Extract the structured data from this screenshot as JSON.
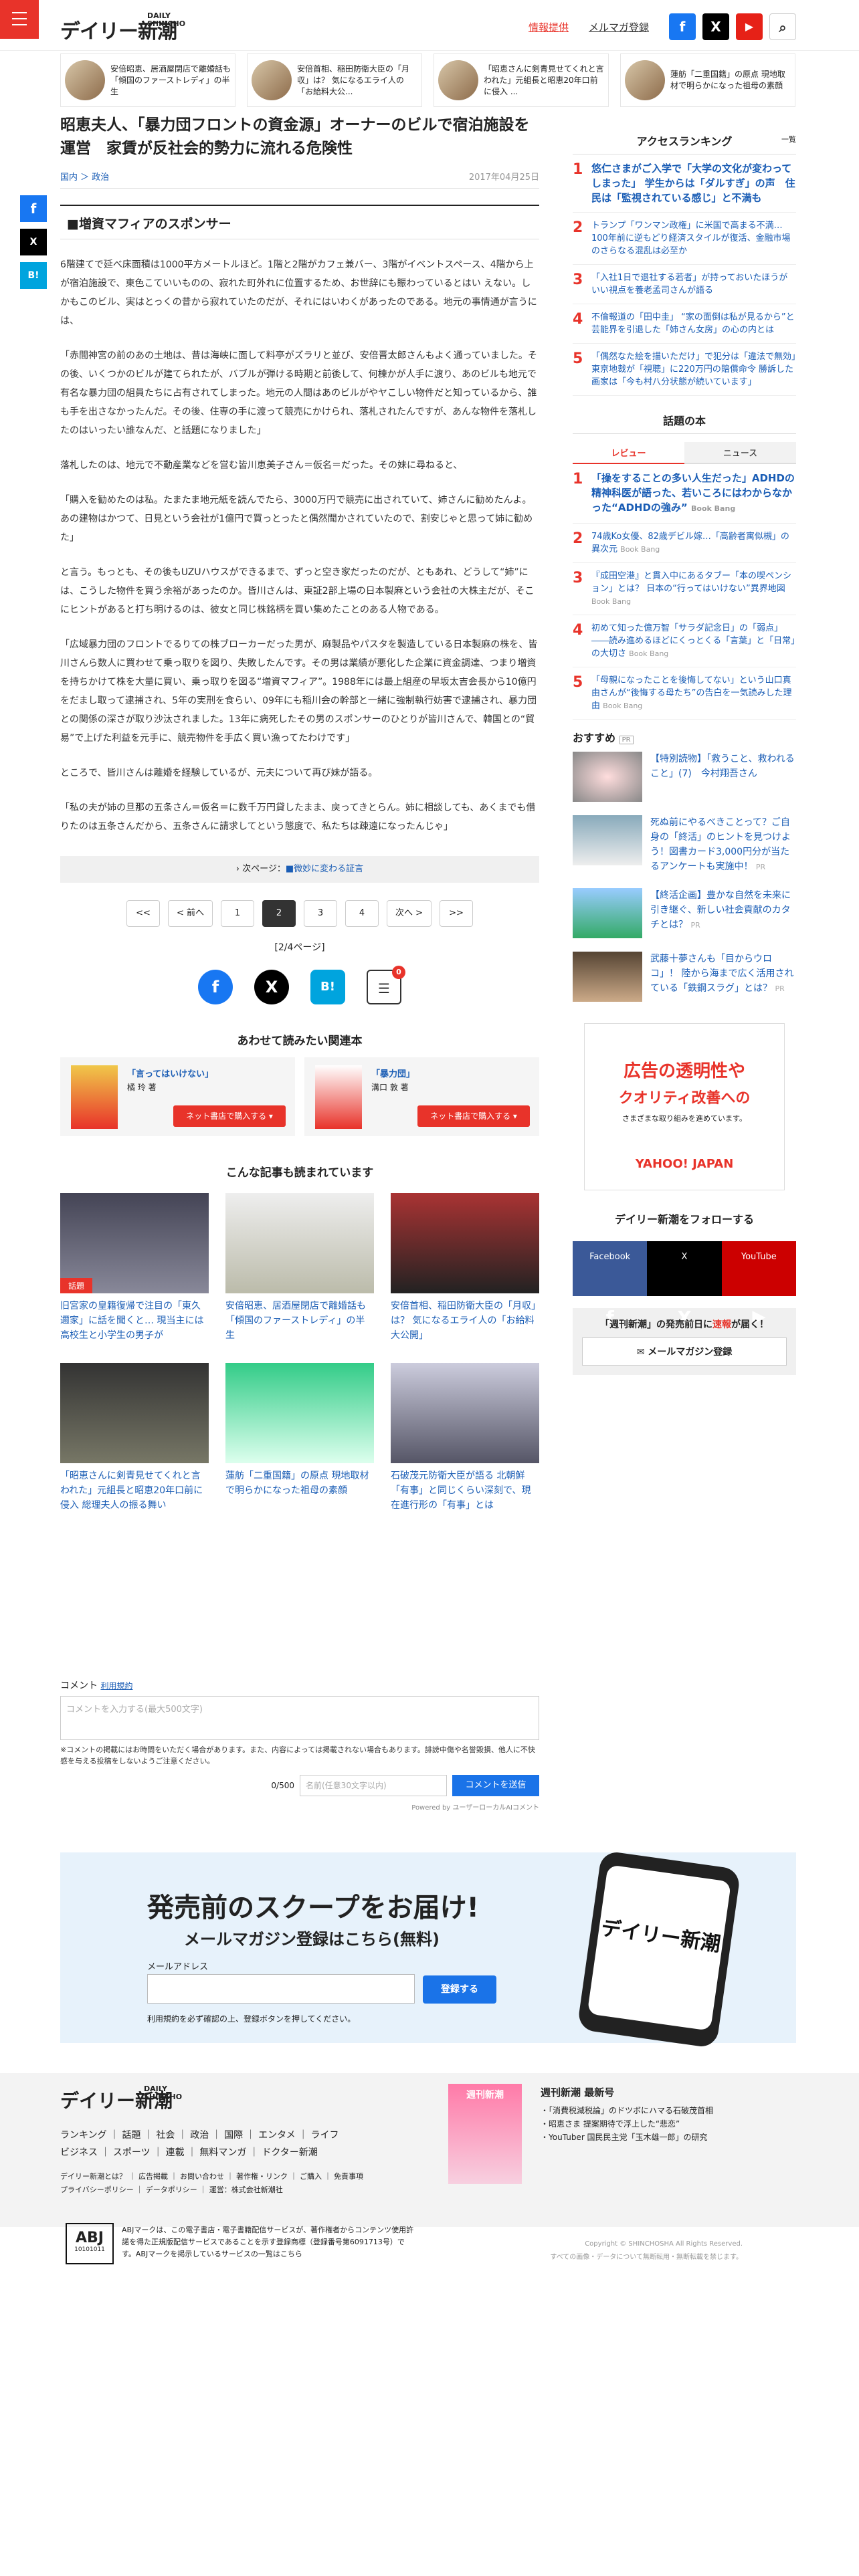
{
  "header": {
    "logo": "デイリー新潮",
    "logo_en": "DAILY SHINCHO",
    "link1": "情報提供",
    "link2": "メルマガ登録",
    "fb": "f",
    "x": "X",
    "yt": "▶",
    "search": "⌕"
  },
  "strip": [
    {
      "text": "安倍昭恵、居酒屋閉店で離婚話も「傾国のファーストレディ」の半生"
    },
    {
      "text": "安倍首相、稲田防衛大臣の「月収」は？ 気になるエライ人の「お給料大公..."
    },
    {
      "text": "「昭恵さんに剣青見せてくれと言われた」元組長と昭恵20年口前に侵入 ..."
    },
    {
      "text": "蓮舫「二重国籍」の原点 現地取材で明らかになった祖母の素顔"
    }
  ],
  "article": {
    "title": "昭恵夫人、「暴力団フロントの資金源」オーナーのビルで宿泊施設を運営　家賃が反社会的勢力に流れる危険性",
    "cat1": "国内",
    "cat2": "政治",
    "date": "2017年04月25日",
    "section": "■増資マフィアのスポンサー",
    "paras": [
      "6階建てで延べ床面積は1000平方メートルほど。1階と2階がカフェ兼バー、3階がイベントスペース、4階から上が宿泊施設で、東色こていいものの、寂れた町外れに位置するため、お世辞にも賑わっているとはい えない。しかもこのビル、実はとっくの昔から寂れていたのだが、それにはいわくがあったのである。地元の事情通が言うには、",
      "「赤間神宮の前のあの土地は、昔は海峡に面して料亭がズラリと並び、安倍晋太郎さんもよく通っていました。その後、いくつかのビルが建てられたが、バブルが弾ける時期と前後して、何棟かが人手に渡り、あのビルも地元で有名な暴力団の組員たちに占有されてしまった。地元の人間はあのビルがやヤこしい物件だと知っているから、誰も手を出さなかったんだ。その後、住専の手に渡って競売にかけられ、落札されたんですが、あんな物件を落札したのはいったい誰なんだ、と話題になりました」",
      "落札したのは、地元で不動産業などを営む皆川恵美子さん＝仮名＝だった。その妹に尋ねると、",
      "「購入を勧めたのは私。たまたま地元紙を読んでたら、3000万円で競売に出されていて、姉さんに勧めたんよ。あの建物はかつて、日見という会社が1億円で買っとったと偶然聞かされていたので、割安じゃと思って姉に勧めた」",
      "と言う。もっとも、その後もUZUハウスができるまで、ずっと空き家だったのだが、ともあれ、どうして“姉”には、こうした物件を買う余裕があったのか。皆川さんは、東証2部上場の日本製麻という会社の大株主だが、そこにヒントがあると打ち明けるのは、彼女と同じ株銘柄を買い集めたことのある人物である。",
      "「広域暴力団のフロントでるりての株ブローカーだった男が、麻製品やパスタを製造している日本製麻の株を、皆川さんら数人に買わせて乗っ取りを図り、失敗したんです。その男は業績が悪化した企業に資金調達、つまり増資を持ちかけて株を大量に買い、乗っ取りを図る“増資マフィア”。1988年には最上組産の早坂太吉会長から10億円をだまし取って逮捕され、5年の実刑を食らい、09年にも稲川会の幹部と一緒に強制執行妨害で逮捕され、暴力団との関係の深さが取り沙汰されました。13年に病死したその男のスポンサーのひとりが皆川さんで、韓国との“貿易”で上げた利益を元手に、競売物件を手広く買い漁ってたわけです」",
      "ところで、皆川さんは離婚を経験しているが、元夫について再び妹が語る。",
      "「私の夫が姉の旦那の五条さん＝仮名＝に数千万円貸したまま、戻ってきとらん。姉に相談しても、あくまでも借りたのは五条さんだから、五条さんに請求してという態度で、私たちは疎遠になったんじゃ」"
    ],
    "next_label": "次ページ：",
    "next_link": "■微妙に変わる証言",
    "pager": [
      "<<",
      "< 前へ",
      "1",
      "2",
      "3",
      "4",
      "次へ >",
      ">>"
    ],
    "page_status": "[2/4ページ]",
    "comment_count": "0"
  },
  "books": {
    "heading": "あわせて読みたい関連本",
    "items": [
      {
        "title": "「言ってはいけない」",
        "author": "橘 玲 著",
        "buy": "ネット書店で購入する ▾"
      },
      {
        "title": "「暴力団」",
        "author": "溝口 敦 著",
        "buy": "ネット書店で購入する ▾"
      }
    ]
  },
  "related": {
    "heading": "こんな記事も読まれています",
    "items": [
      {
        "title": "旧宮家の皇籍復帰で注目の「東久邇家」に話を聞くと… 現当主には高校生と小学生の男子が",
        "tag": "話題"
      },
      {
        "title": "安倍昭恵、居酒屋閉店で離婚話も 「傾国のファーストレディ」の半生",
        "tag": ""
      },
      {
        "title": "安倍首相、稲田防衛大臣の「月収」は？ 気になるエライ人の「お給料大公開」",
        "tag": ""
      },
      {
        "title": "「昭恵さんに剣青見せてくれと言われた」元組長と昭恵20年口前に侵入 総理夫人の振る舞い",
        "tag": ""
      },
      {
        "title": "蓮舫「二重国籍」の原点 現地取材で明らかになった祖母の素顔",
        "tag": ""
      },
      {
        "title": "石破茂元防衛大臣が語る 北朝鮮「有事」と同じくらい深刻で、現在進行形の「有事」とは",
        "tag": ""
      }
    ]
  },
  "comments": {
    "label": "コメント",
    "rule": "利用規約",
    "placeholder": "コメントを入力する(最大500文字)",
    "note": "※コメントの掲載にはお時間をいただく場合があります。また、内容によっては掲載されない場合もあります。誹謗中傷や名誉毀損、他人に不快感を与える投稿をしないようご注意ください。",
    "count": "0/500",
    "name_ph": "名前(任意30文字以内)",
    "send": "コメントを送信",
    "powered": "Powered by ユーザーローカルAIコメント"
  },
  "banner": {
    "title": "発売前のスクープをお届け!",
    "sub": "メールマガジン登録はこちら(無料)",
    "email_label": "メールアドレス",
    "btn": "登録する",
    "note": "利用規約を必ず確認の上、登録ボタンを押してください。",
    "phone": "デイリー新潮"
  },
  "sidebar": {
    "access": "アクセスランキング",
    "all": "一覧",
    "ranking": [
      {
        "n": "1",
        "t": "悠仁さまがご入学で「大学の文化が変わってしまった」 学生からは「ダルすぎ」の声　住民は「監視されている感じ」と不満も",
        "big": true
      },
      {
        "n": "2",
        "t": "トランプ「ワンマン政権」に米国で高まる不満…100年前に逆もどり経済スタイルが復活、金融市場のさらなる混乱は必至か",
        "big": false
      },
      {
        "n": "3",
        "t": "「入社1日で退社する若者」が持っておいたほうがいい視点を養老孟司さんが語る",
        "big": false
      },
      {
        "n": "4",
        "t": "不倫報道の「田中圭」 “家の面倒は私が見るから”と芸能界を引退した「姉さん女房」の心の内とは",
        "big": false
      },
      {
        "n": "5",
        "t": "「偶然なた絵を描いただけ」で犯分は「違法で無効」東京地裁が「視聴」に220万円の賠償命令 勝訴した画家は「今も村八分状態が続いています」",
        "big": false
      }
    ],
    "books_head": "話題の本",
    "tab1": "レビュー",
    "tab2": "ニュース",
    "book_rank": [
      {
        "n": "1",
        "t": "「操をすることの多い人生だった」ADHDの精神科医が語った、若いころにはわからなかった“ADHDの強み”",
        "em": "Book Bang",
        "big": true
      },
      {
        "n": "2",
        "t": "74歳Ko女優、82歳デビル嫁…「高齢者寓似槻」の異次元",
        "em": "Book Bang",
        "big": false
      },
      {
        "n": "3",
        "t": "『成田空港』と貫入中にあるタブー「本の喫ペンション」とは？ 日本の“行ってはいけない”異界地図",
        "em": "Book Bang",
        "big": false
      },
      {
        "n": "4",
        "t": "初めて知った億万智「サラダ記念日」の「弱点」――読み進めるほどにくっとくる「言葉」と「日常」の大切さ",
        "em": "Book Bang",
        "big": false
      },
      {
        "n": "5",
        "t": "「母親になったことを後悔してない」という山口真由さんが“後悔する母たち”の告白を一気読みした理由",
        "em": "Book Bang",
        "big": false
      }
    ],
    "osusume": "おすすめ",
    "pr": "PR",
    "recs": [
      {
        "t": "【特別読物】「救うこと、救われること」(7)　今村翔吾さん",
        "pr": "PR"
      },
      {
        "t": "死ぬ前にやるべきことって？ご自身の「終活」のヒントを見つけよう！図書カード3,000円分が当たるアンケートも実施中！",
        "pr": "PR"
      },
      {
        "t": "【終活企画】豊かな自然を未来に引き継ぐ、新しい社会貢献のカタチとは？",
        "pr": "PR"
      },
      {
        "t": "武藤十夢さんも「目からウロコ」！ 陸から海まで広く活用されている「鉄鋼スラグ」とは？",
        "pr": "PR"
      }
    ],
    "ad_line1": "広告の透明性や",
    "ad_line2": "クオリティ改善への",
    "ad_line3": "さまざまな取り組みを進めています。",
    "ad_brand": "YAHOO! JAPAN",
    "follow": "デイリー新潮をフォローする",
    "fb": "Facebook",
    "x": "X",
    "yt": "YouTube",
    "mail1": "「週刊新潮」の発売前日に",
    "mail2": "速報",
    "mail3": "が届く！",
    "mail_btn": "メールマガジン登録"
  },
  "footer": {
    "logo": "デイリー新潮",
    "logo_en": "DAILY SHINCHO",
    "nav1": "ランキング ｜ 話題 ｜ 社会 ｜ 政治 ｜ 国際 ｜ エンタメ ｜ ライフ",
    "nav2": "ビジネス ｜ スポーツ ｜ 連載 ｜ 無料マンガ ｜ ドクター新潮",
    "small1": "デイリー新潮とは？ ｜ 広告掲載 ｜ お問い合わせ ｜ 著作権・リンク ｜ ご購入 ｜ 免責事項",
    "small2": "プライバシーポリシー ｜ データポリシー ｜ 運営：株式会社新潮社",
    "mag_title": "週刊新潮",
    "mag_head": "週刊新潮 最新号",
    "mag_items": [
      "「消費税減税論」のドツボにハマる石破茂首相",
      "昭恵さま 提案期待で浮上した“悲恋”",
      "YouTuber 国民民主党「玉木雄一郎」の研究"
    ],
    "abj": "ABJマークは、この電子書店・電子書籍配信サービスが、著作権者からコンテンツ使用許諾を得た正規版配信サービスであることを示す登録商標（登録番号第6091713号）です。ABJマークを掲示しているサービスの一覧はこちら",
    "abj_mark": "ABJ",
    "abj_num": "10101011",
    "copyright": "Copyright © SHINCHOSHA All Rights Reserved.",
    "copy2": "すべての画像・データについて無断転用・無断転載を禁じます。"
  }
}
